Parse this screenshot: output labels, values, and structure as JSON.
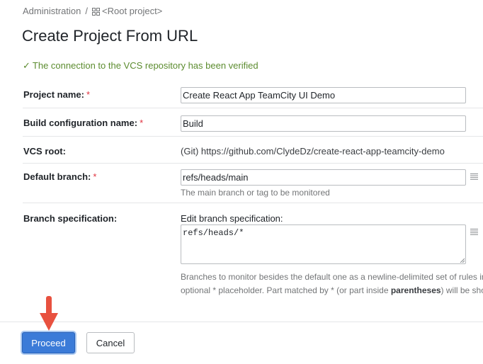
{
  "breadcrumb": {
    "administration": "Administration",
    "separator": "/",
    "root_project": "<Root project>",
    "project_icon": "grid-icon"
  },
  "page": {
    "title": "Create Project From URL"
  },
  "status": {
    "icon": "check-icon",
    "message": "The connection to the VCS repository has been verified",
    "color": "#5c8c2f"
  },
  "form": {
    "project_name": {
      "label": "Project name:",
      "required_mark": "*",
      "value": "Create React App TeamCity UI Demo"
    },
    "build_config_name": {
      "label": "Build configuration name:",
      "required_mark": "*",
      "value": "Build"
    },
    "vcs_root": {
      "label": "VCS root:",
      "value": "(Git) https://github.com/ClydeDz/create-react-app-teamcity-demo"
    },
    "default_branch": {
      "label": "Default branch:",
      "required_mark": "*",
      "value": "refs/heads/main",
      "hint": "The main branch or tag to be monitored",
      "icon": "list-icon"
    },
    "branch_spec": {
      "label": "Branch specification:",
      "edit_label": "Edit branch specification:",
      "value": "refs/heads/*",
      "icon": "list-icon",
      "hint_line1": "Branches to monitor besides the default one as a newline-delimited set of rules in t",
      "hint_line2_before": "optional * placeholder. Part matched by * (or part inside ",
      "hint_line2_bold": "parentheses",
      "hint_line2_after": ") will be show"
    }
  },
  "buttons": {
    "proceed": "Proceed",
    "cancel": "Cancel"
  },
  "colors": {
    "primary": "#3b7bd8",
    "required": "#e0323f",
    "annotation_arrow": "#e8513f"
  }
}
